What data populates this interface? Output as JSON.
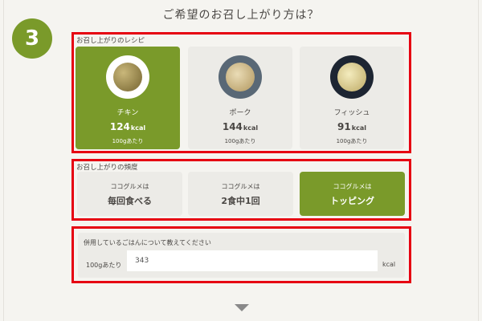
{
  "step_number": "3",
  "question": "ご希望のお召し上がり方は？",
  "recipe_section": {
    "label": "お召し上がりのレシピ",
    "cards": [
      {
        "name": "チキン",
        "kcal": "124",
        "unit": "kcal",
        "per": "100gあたり",
        "selected": true,
        "image": "chicken-dish-image"
      },
      {
        "name": "ポーク",
        "kcal": "144",
        "unit": "kcal",
        "per": "100gあたり",
        "selected": false,
        "image": "pork-dish-image"
      },
      {
        "name": "フィッシュ",
        "kcal": "91",
        "unit": "kcal",
        "per": "100gあたり",
        "selected": false,
        "image": "fish-dish-image"
      }
    ]
  },
  "frequency_section": {
    "label": "お召し上がりの頻度",
    "options": [
      {
        "top": "ココグルメは",
        "main": "毎回食べる",
        "selected": false
      },
      {
        "top": "ココグルメは",
        "main": "2食中1回",
        "selected": false
      },
      {
        "top": "ココグルメは",
        "main": "トッピング",
        "selected": true
      }
    ]
  },
  "rice_section": {
    "question": "併用しているごはんについて教えてください",
    "prefix": "100gあたり",
    "value": "343",
    "unit": "kcal"
  },
  "colors": {
    "accent": "#7a9a2a",
    "highlight_frame": "#e60012",
    "background": "#f5f4f0",
    "card": "#ecebe7"
  },
  "icons": {
    "next": "chevron-down-icon"
  }
}
